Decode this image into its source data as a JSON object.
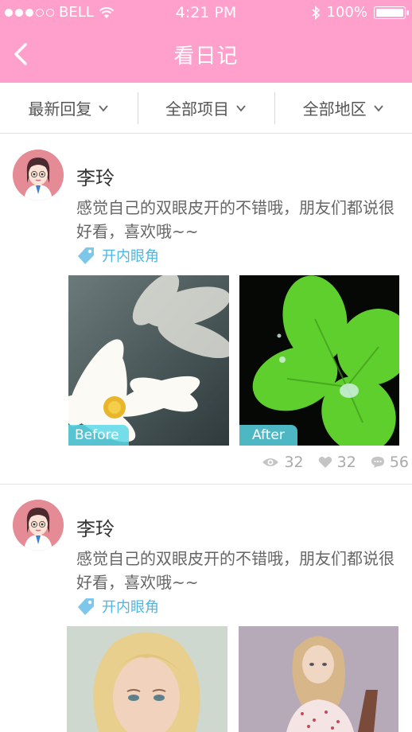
{
  "status": {
    "carrier": "BELL",
    "time": "4:21 PM",
    "battery": "100%"
  },
  "nav": {
    "title": "看日记"
  },
  "filters": [
    {
      "label": "最新回复"
    },
    {
      "label": "全部项目"
    },
    {
      "label": "全部地区"
    }
  ],
  "posts": [
    {
      "name": "李玲",
      "text": "感觉自己的双眼皮开的不错哦，朋友们都说很好看，喜欢哦~~",
      "tag": "开内眼角",
      "before_label": "Before",
      "after_label": "After",
      "views": "32",
      "likes": "32",
      "comments": "56"
    },
    {
      "name": "李玲",
      "text": "感觉自己的双眼皮开的不错哦，朋友们都说很好看，喜欢哦~~",
      "tag": "开内眼角"
    }
  ],
  "colors": {
    "header": "#ff9fcb",
    "accent": "#4fb6e2",
    "photo_label": "#5ad7e6"
  }
}
